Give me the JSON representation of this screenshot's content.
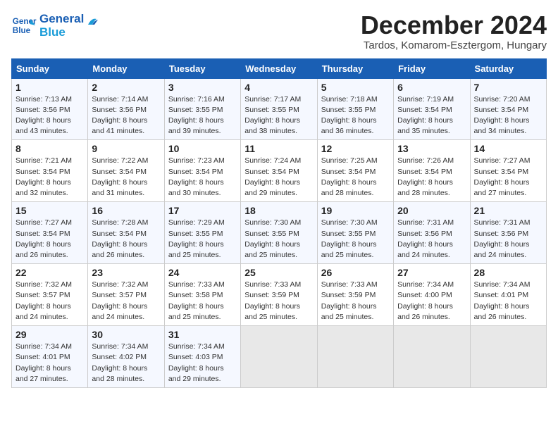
{
  "logo": {
    "line1": "General",
    "line2": "Blue"
  },
  "title": "December 2024",
  "subtitle": "Tardos, Komarom-Esztergom, Hungary",
  "header": {
    "cols": [
      "Sunday",
      "Monday",
      "Tuesday",
      "Wednesday",
      "Thursday",
      "Friday",
      "Saturday"
    ]
  },
  "weeks": [
    [
      {
        "day": "1",
        "info": "Sunrise: 7:13 AM\nSunset: 3:56 PM\nDaylight: 8 hours\nand 43 minutes."
      },
      {
        "day": "2",
        "info": "Sunrise: 7:14 AM\nSunset: 3:56 PM\nDaylight: 8 hours\nand 41 minutes."
      },
      {
        "day": "3",
        "info": "Sunrise: 7:16 AM\nSunset: 3:55 PM\nDaylight: 8 hours\nand 39 minutes."
      },
      {
        "day": "4",
        "info": "Sunrise: 7:17 AM\nSunset: 3:55 PM\nDaylight: 8 hours\nand 38 minutes."
      },
      {
        "day": "5",
        "info": "Sunrise: 7:18 AM\nSunset: 3:55 PM\nDaylight: 8 hours\nand 36 minutes."
      },
      {
        "day": "6",
        "info": "Sunrise: 7:19 AM\nSunset: 3:54 PM\nDaylight: 8 hours\nand 35 minutes."
      },
      {
        "day": "7",
        "info": "Sunrise: 7:20 AM\nSunset: 3:54 PM\nDaylight: 8 hours\nand 34 minutes."
      }
    ],
    [
      {
        "day": "8",
        "info": "Sunrise: 7:21 AM\nSunset: 3:54 PM\nDaylight: 8 hours\nand 32 minutes."
      },
      {
        "day": "9",
        "info": "Sunrise: 7:22 AM\nSunset: 3:54 PM\nDaylight: 8 hours\nand 31 minutes."
      },
      {
        "day": "10",
        "info": "Sunrise: 7:23 AM\nSunset: 3:54 PM\nDaylight: 8 hours\nand 30 minutes."
      },
      {
        "day": "11",
        "info": "Sunrise: 7:24 AM\nSunset: 3:54 PM\nDaylight: 8 hours\nand 29 minutes."
      },
      {
        "day": "12",
        "info": "Sunrise: 7:25 AM\nSunset: 3:54 PM\nDaylight: 8 hours\nand 28 minutes."
      },
      {
        "day": "13",
        "info": "Sunrise: 7:26 AM\nSunset: 3:54 PM\nDaylight: 8 hours\nand 28 minutes."
      },
      {
        "day": "14",
        "info": "Sunrise: 7:27 AM\nSunset: 3:54 PM\nDaylight: 8 hours\nand 27 minutes."
      }
    ],
    [
      {
        "day": "15",
        "info": "Sunrise: 7:27 AM\nSunset: 3:54 PM\nDaylight: 8 hours\nand 26 minutes."
      },
      {
        "day": "16",
        "info": "Sunrise: 7:28 AM\nSunset: 3:54 PM\nDaylight: 8 hours\nand 26 minutes."
      },
      {
        "day": "17",
        "info": "Sunrise: 7:29 AM\nSunset: 3:55 PM\nDaylight: 8 hours\nand 25 minutes."
      },
      {
        "day": "18",
        "info": "Sunrise: 7:30 AM\nSunset: 3:55 PM\nDaylight: 8 hours\nand 25 minutes."
      },
      {
        "day": "19",
        "info": "Sunrise: 7:30 AM\nSunset: 3:55 PM\nDaylight: 8 hours\nand 25 minutes."
      },
      {
        "day": "20",
        "info": "Sunrise: 7:31 AM\nSunset: 3:56 PM\nDaylight: 8 hours\nand 24 minutes."
      },
      {
        "day": "21",
        "info": "Sunrise: 7:31 AM\nSunset: 3:56 PM\nDaylight: 8 hours\nand 24 minutes."
      }
    ],
    [
      {
        "day": "22",
        "info": "Sunrise: 7:32 AM\nSunset: 3:57 PM\nDaylight: 8 hours\nand 24 minutes."
      },
      {
        "day": "23",
        "info": "Sunrise: 7:32 AM\nSunset: 3:57 PM\nDaylight: 8 hours\nand 24 minutes."
      },
      {
        "day": "24",
        "info": "Sunrise: 7:33 AM\nSunset: 3:58 PM\nDaylight: 8 hours\nand 25 minutes."
      },
      {
        "day": "25",
        "info": "Sunrise: 7:33 AM\nSunset: 3:59 PM\nDaylight: 8 hours\nand 25 minutes."
      },
      {
        "day": "26",
        "info": "Sunrise: 7:33 AM\nSunset: 3:59 PM\nDaylight: 8 hours\nand 25 minutes."
      },
      {
        "day": "27",
        "info": "Sunrise: 7:34 AM\nSunset: 4:00 PM\nDaylight: 8 hours\nand 26 minutes."
      },
      {
        "day": "28",
        "info": "Sunrise: 7:34 AM\nSunset: 4:01 PM\nDaylight: 8 hours\nand 26 minutes."
      }
    ],
    [
      {
        "day": "29",
        "info": "Sunrise: 7:34 AM\nSunset: 4:01 PM\nDaylight: 8 hours\nand 27 minutes."
      },
      {
        "day": "30",
        "info": "Sunrise: 7:34 AM\nSunset: 4:02 PM\nDaylight: 8 hours\nand 28 minutes."
      },
      {
        "day": "31",
        "info": "Sunrise: 7:34 AM\nSunset: 4:03 PM\nDaylight: 8 hours\nand 29 minutes."
      },
      null,
      null,
      null,
      null
    ]
  ]
}
